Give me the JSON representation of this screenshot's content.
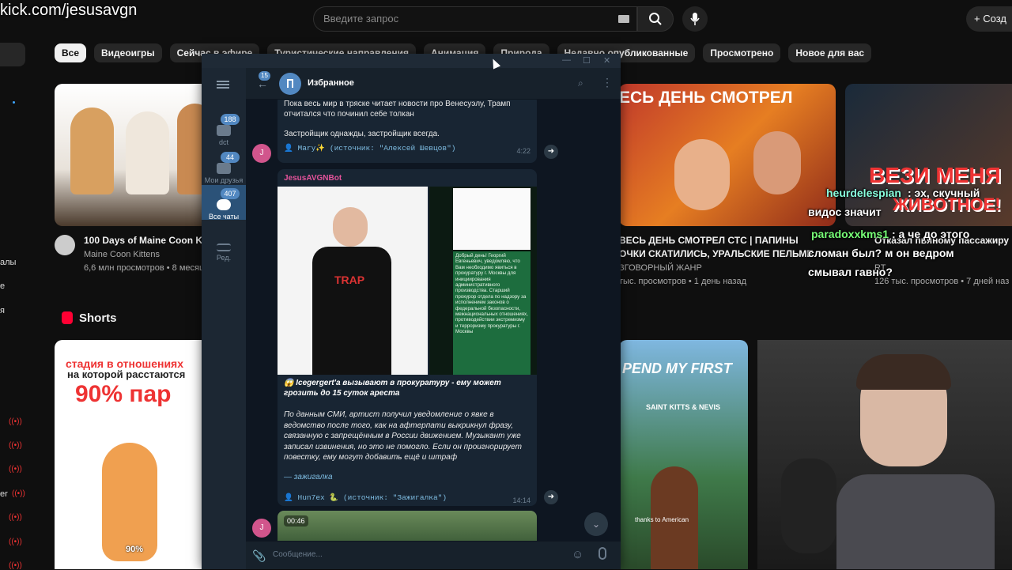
{
  "stream": {
    "url": "kick.com/jesusavgn"
  },
  "youtube": {
    "search_placeholder": "Введите запрос",
    "create_label": "Созд",
    "chips": [
      "Все",
      "Видеоигры",
      "Сейчас в эфире",
      "Туристические направления",
      "Анимация",
      "Природа",
      "Недавно опубликованные",
      "Просмотрено",
      "Новое для вас"
    ],
    "sidebar_labels": [
      "алы",
      "е",
      "я",
      "er"
    ],
    "shorts_label": "Shorts",
    "videos": [
      {
        "title": "100 Days of Maine Coon Ki",
        "channel": "Maine Coon Kittens",
        "meta": "6,6 млн просмотров • 8 месяц"
      },
      {
        "title": "ВЕСЬ ДЕНЬ СМОТРЕЛ СТС | ПАПИНЫ",
        "title2": "ОЧКИ СКАТИЛИСЬ, УРАЛЬСКИЕ ПЕЛЬМЕ",
        "channel": "ЗГОВОРНЫЙ ЖАНР",
        "meta": "тыс. просмотров • 1 день назад",
        "thumb_text": "ЕСЬ ДЕНЬ СМОТРЕЛ"
      },
      {
        "title": "Отказал пьяному пассажиру в",
        "channel": "RT",
        "meta": "126 тыс. просмотров • 7 дней наз",
        "thumb_text": "ВЕЗИ МЕНЯ",
        "thumb_text2": "ЖИВОТНОЕ!"
      }
    ],
    "shorts": [
      {
        "line1": "стадия в отношениях",
        "line2": "на которой расстаются",
        "line3": "90% пар",
        "caption": "90%"
      },
      {
        "line1": "PEND MY FIRST",
        "line2": "SAINT KITTS & NEVIS",
        "caption": "thanks to American"
      }
    ]
  },
  "overlay_chat": [
    {
      "user": "heurdelespian",
      "text": ": эх, скучный"
    },
    {
      "user": "",
      "text": "видос значит"
    },
    {
      "user": "paradoxxkms1",
      "text": ": а че до этого"
    },
    {
      "user": "",
      "text": "сломан был? м он ведром"
    },
    {
      "user": "",
      "text": "смывал гавно?"
    }
  ],
  "telegram": {
    "back_badge": "15",
    "chat_title": "Избранное",
    "folders": [
      {
        "label": "dct",
        "badge": "188"
      },
      {
        "label": "Мои друзья",
        "badge": "44"
      },
      {
        "label": "Все чаты",
        "badge": "407"
      },
      {
        "label": "Ред.",
        "badge": ""
      }
    ],
    "msg1": {
      "text1": "Пока весь мир в тряске читает новости про Венесуэлу, Трамп",
      "text2": "отчитался что починил себе толкан",
      "text3": "Застройщик однажды, застройщик всегда.",
      "source": "👤 Mary✨ (источник: \"Алексей Шевцов\")",
      "time": "4:22"
    },
    "msg2": {
      "sender": "JesusAVGNBot",
      "shirt_text": "TRAP",
      "doc_text": "Добрый день! Георгий Евгеньевич, уведомляю, что Вам необходимо явиться в прокуратуру г. Москвы для инициирования административного производства. Старший прокурор отдела по надзору за исполнением законов о федеральной безопасности, межнациональных отношениях, противодействии экстремизму и терроризму прокуратуры г. Москвы",
      "headline": "😱 Icegergert'а вызывают в прокуратуру - ему может грозить до 15 суток ареста",
      "body": "По данным СМИ, артист получил уведомление о явке в ведомство после того, как на афтерпати выкрикнул фразу, связанную с запрещённым в России движением. Музыкант уже записал извинения, но это не помогло. Если он проигнорирует повестку, ему могут добавить ещё и штраф",
      "signature": "— зажигалка",
      "source": "👤 Hun7ex 🐍 (источник: \"Зажигалка\")",
      "time": "14:14"
    },
    "msg3": {
      "duration": "00:46"
    },
    "avatar_letter": "J",
    "input_placeholder": "Сообщение..."
  }
}
